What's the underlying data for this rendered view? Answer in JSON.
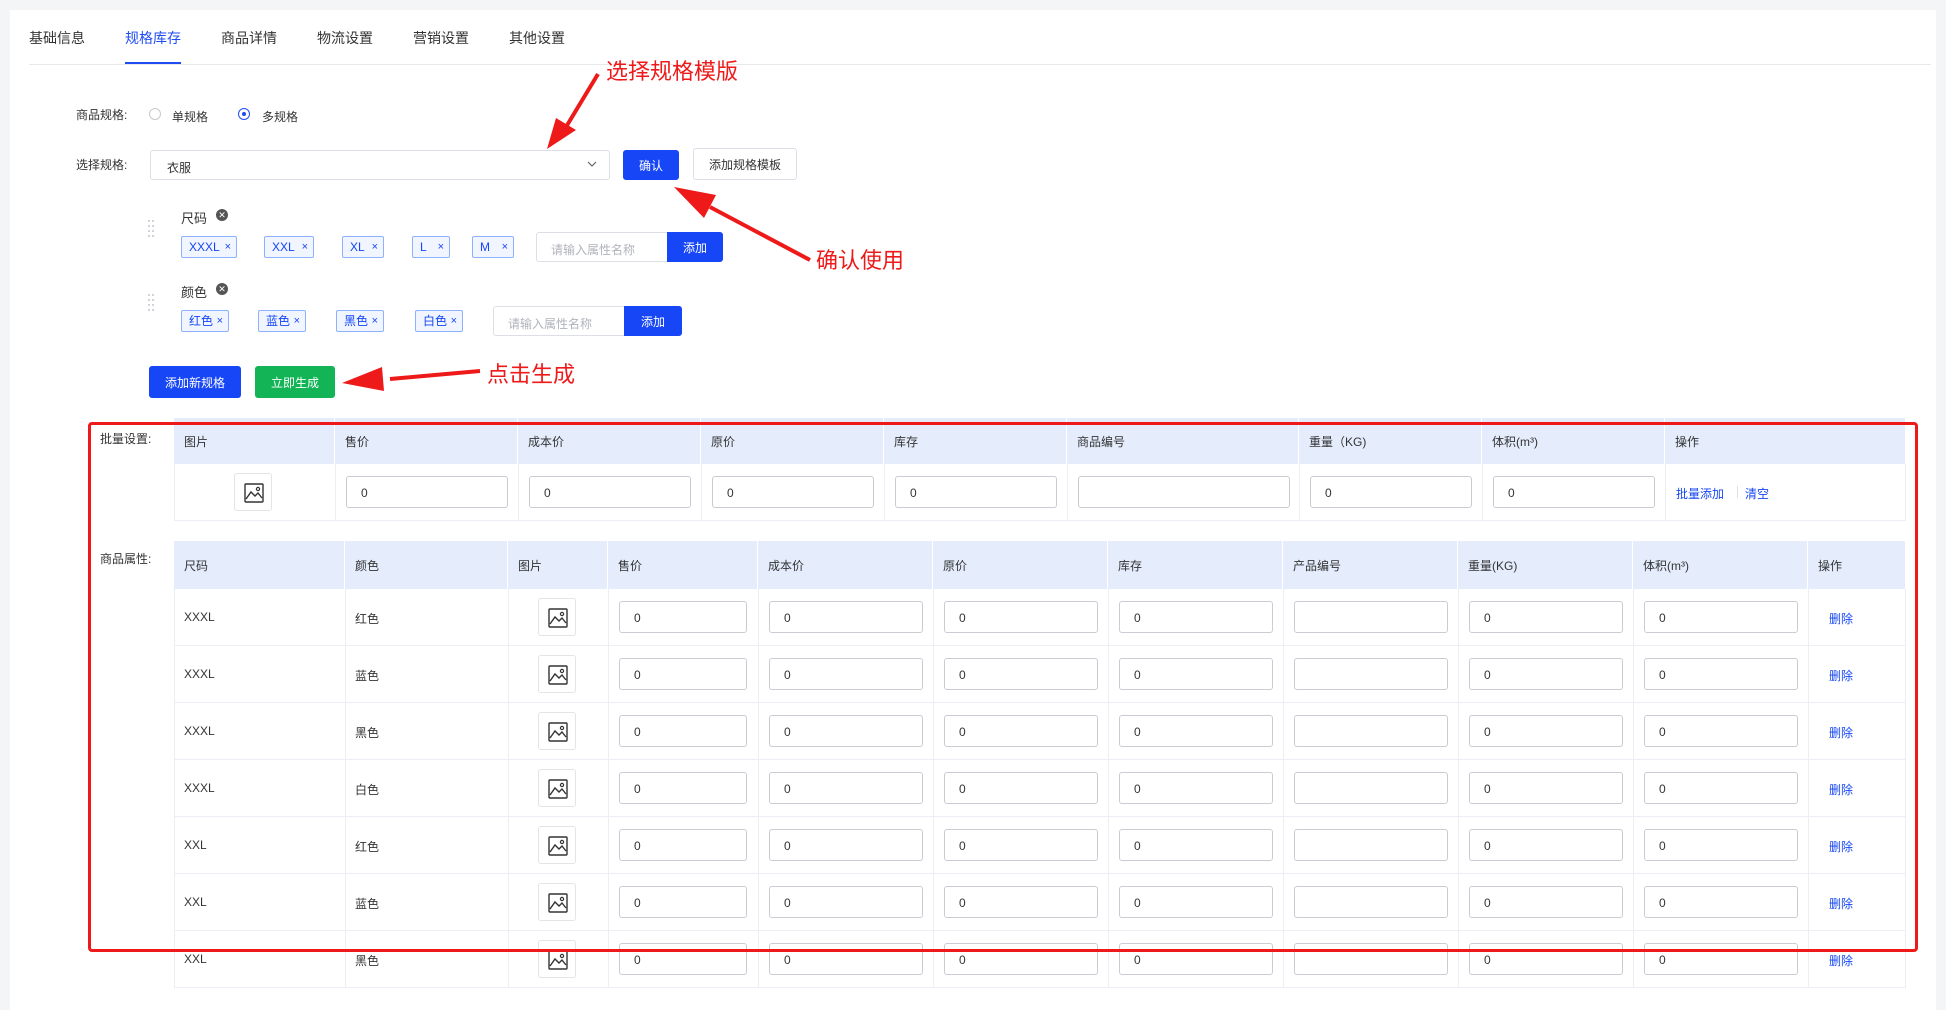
{
  "tabs": [
    {
      "label": "基础信息",
      "active": false
    },
    {
      "label": "规格库存",
      "active": true
    },
    {
      "label": "商品详情",
      "active": false
    },
    {
      "label": "物流设置",
      "active": false
    },
    {
      "label": "营销设置",
      "active": false
    },
    {
      "label": "其他设置",
      "active": false
    }
  ],
  "spec_type": {
    "label": "商品规格:",
    "options": [
      {
        "label": "单规格",
        "checked": false
      },
      {
        "label": "多规格",
        "checked": true
      }
    ]
  },
  "spec_select": {
    "label": "选择规格:",
    "value": "衣服",
    "confirm_label": "确认",
    "add_template_label": "添加规格模板"
  },
  "spec_groups": [
    {
      "name": "尺码",
      "tags": [
        "XXXL",
        "XXL",
        "XL",
        "L",
        "M"
      ],
      "input_placeholder": "请输入属性名称",
      "add_label": "添加"
    },
    {
      "name": "颜色",
      "tags": [
        "红色",
        "蓝色",
        "黑色",
        "白色"
      ],
      "input_placeholder": "请输入属性名称",
      "add_label": "添加"
    }
  ],
  "actions": {
    "add_spec_label": "添加新规格",
    "generate_label": "立即生成"
  },
  "batch": {
    "label": "批量设置:",
    "headers": [
      "图片",
      "售价",
      "成本价",
      "原价",
      "库存",
      "商品编号",
      "重量（KG)",
      "体积(m³)",
      "操作"
    ],
    "values": {
      "price": "0",
      "cost": "0",
      "original": "0",
      "stock": "0",
      "code": "",
      "weight": "0",
      "volume": "0"
    },
    "batch_add_label": "批量添加",
    "clear_label": "清空"
  },
  "attrs": {
    "label": "商品属性:",
    "headers": [
      "尺码",
      "颜色",
      "图片",
      "售价",
      "成本价",
      "原价",
      "库存",
      "产品编号",
      "重量(KG)",
      "体积(m³)",
      "操作"
    ],
    "delete_label": "删除",
    "rows": [
      {
        "size": "XXXL",
        "color": "红色",
        "price": "0",
        "cost": "0",
        "original": "0",
        "stock": "0",
        "code": "",
        "weight": "0",
        "volume": "0"
      },
      {
        "size": "XXXL",
        "color": "蓝色",
        "price": "0",
        "cost": "0",
        "original": "0",
        "stock": "0",
        "code": "",
        "weight": "0",
        "volume": "0"
      },
      {
        "size": "XXXL",
        "color": "黑色",
        "price": "0",
        "cost": "0",
        "original": "0",
        "stock": "0",
        "code": "",
        "weight": "0",
        "volume": "0"
      },
      {
        "size": "XXXL",
        "color": "白色",
        "price": "0",
        "cost": "0",
        "original": "0",
        "stock": "0",
        "code": "",
        "weight": "0",
        "volume": "0"
      },
      {
        "size": "XXL",
        "color": "红色",
        "price": "0",
        "cost": "0",
        "original": "0",
        "stock": "0",
        "code": "",
        "weight": "0",
        "volume": "0"
      },
      {
        "size": "XXL",
        "color": "蓝色",
        "price": "0",
        "cost": "0",
        "original": "0",
        "stock": "0",
        "code": "",
        "weight": "0",
        "volume": "0"
      },
      {
        "size": "XXL",
        "color": "黑色",
        "price": "0",
        "cost": "0",
        "original": "0",
        "stock": "0",
        "code": "",
        "weight": "0",
        "volume": "0"
      }
    ]
  },
  "annotations": {
    "select_template": "选择规格模版",
    "confirm_use": "确认使用",
    "click_generate": "点击生成"
  },
  "colors": {
    "primary": "#1646f5",
    "success": "#12b455",
    "annotation": "#ee1a1a",
    "table_header": "#e5edfd"
  }
}
